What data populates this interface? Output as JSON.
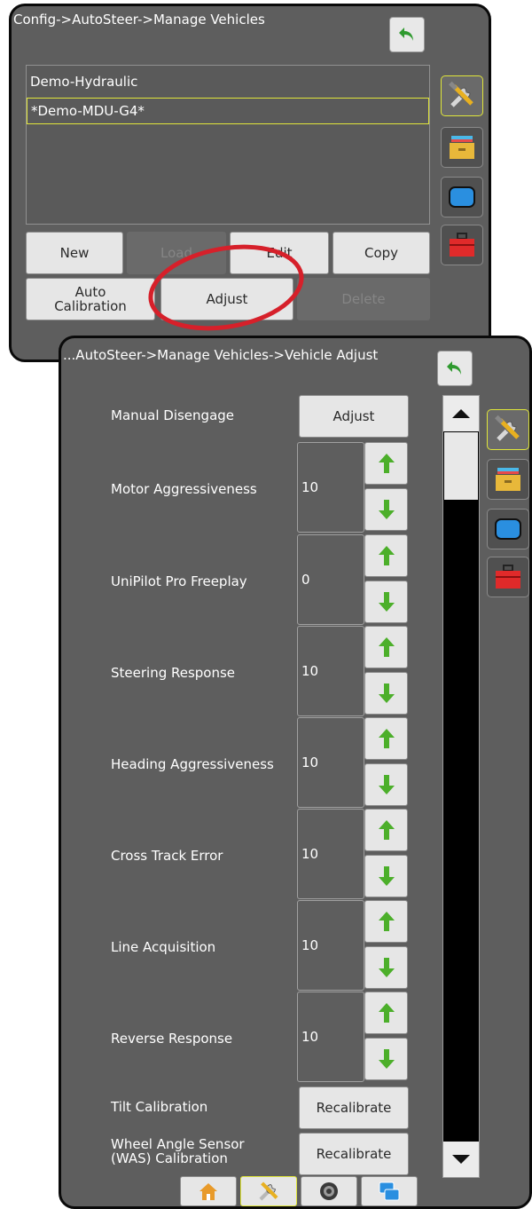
{
  "top_panel": {
    "breadcrumb": "Config->AutoSteer->Manage Vehicles",
    "vehicles": [
      "Demo-Hydraulic",
      "*Demo-MDU-G4*"
    ],
    "buttons": {
      "new": "New",
      "load": "Load",
      "edit": "Edit",
      "copy": "Copy",
      "auto_calibration": "Auto\nCalibration",
      "adjust": "Adjust",
      "delete": "Delete"
    }
  },
  "bottom_panel": {
    "breadcrumb": "...AutoSteer->Manage Vehicles->Vehicle Adjust",
    "manual_disengage": {
      "label": "Manual Disengage",
      "button": "Adjust"
    },
    "settings": [
      {
        "label": "Motor Aggressiveness",
        "value": "10"
      },
      {
        "label": "UniPilot Pro Freeplay",
        "value": "0"
      },
      {
        "label": "Steering Response",
        "value": "10"
      },
      {
        "label": "Heading Aggressiveness",
        "value": "10"
      },
      {
        "label": "Cross Track Error",
        "value": "10"
      },
      {
        "label": "Line Acquisition",
        "value": "10"
      },
      {
        "label": "Reverse Response",
        "value": "10"
      }
    ],
    "tilt_calibration": {
      "label": "Tilt Calibration",
      "button": "Recalibrate"
    },
    "was_calibration": {
      "label": "Wheel Angle Sensor\n(WAS) Calibration",
      "button": "Recalibrate"
    }
  },
  "side_tabs": [
    "tools-icon",
    "console-icon",
    "screen-icon",
    "toolbox-icon"
  ],
  "bottom_tabs": [
    "home-icon",
    "tools-icon",
    "gauge-icon",
    "windows-icon"
  ],
  "colors": {
    "panel_bg": "#5e5e5e",
    "selection": "#e0e63a",
    "annotation": "#d6202a",
    "arrow_green": "#4caf2a",
    "back_green": "#2f9a2f"
  }
}
